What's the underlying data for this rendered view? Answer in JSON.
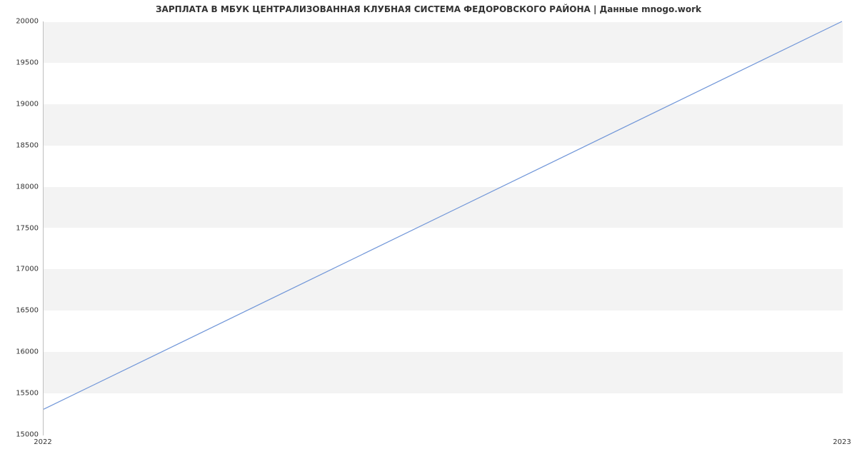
{
  "chart_data": {
    "type": "line",
    "title": "ЗАРПЛАТА В МБУК ЦЕНТРАЛИЗОВАННАЯ КЛУБНАЯ СИСТЕМА ФЕДОРОВСКОГО РАЙОНА | Данные mnogo.work",
    "x": [
      2022,
      2023
    ],
    "values": [
      15300,
      20000
    ],
    "xlabel": "",
    "ylabel": "",
    "xlim": [
      2022,
      2023
    ],
    "ylim": [
      15000,
      20000
    ],
    "yticks": [
      15000,
      15500,
      16000,
      16500,
      17000,
      17500,
      18000,
      18500,
      19000,
      19500,
      20000
    ],
    "xticks": [
      2022,
      2023
    ],
    "line_color": "#6f95d8",
    "band_color": "#f3f3f3"
  }
}
